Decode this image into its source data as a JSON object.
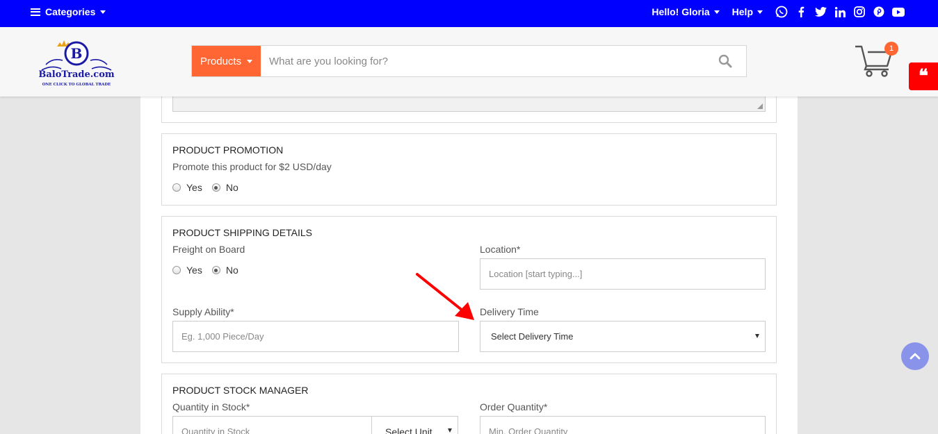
{
  "topbar": {
    "categories_label": "Categories",
    "greeting": "Hello! Gloria",
    "help_label": "Help",
    "social_icons": [
      "whatsapp-icon",
      "facebook-icon",
      "twitter-icon",
      "linkedin-icon",
      "instagram-icon",
      "pinterest-icon",
      "youtube-icon"
    ]
  },
  "header": {
    "logo_letter": "B",
    "logo_name": "BaloTrade.com",
    "logo_tagline": "ONE CLICK TO GLOBAL TRADE",
    "search_category": "Products",
    "search_placeholder": "What are you looking for?",
    "cart_count": "1"
  },
  "promotion": {
    "title": "PRODUCT PROMOTION",
    "description": "Promote this product for $2 USD/day",
    "options": [
      "Yes",
      "No"
    ],
    "selected": "No"
  },
  "shipping": {
    "title": "PRODUCT SHIPPING DETAILS",
    "fob_label": "Freight on Board",
    "fob_options": [
      "Yes",
      "No"
    ],
    "fob_selected": "No",
    "location_label": "Location*",
    "location_placeholder": "Location [start typing...]",
    "supply_label": "Supply Ability*",
    "supply_placeholder": "Eg. 1,000 Piece/Day",
    "delivery_label": "Delivery Time",
    "delivery_value": "Select Delivery Time"
  },
  "stock": {
    "title": "PRODUCT STOCK MANAGER",
    "quantity_label": "Quantity in Stock*",
    "quantity_placeholder": "Quantity in Stock",
    "unit_value": "Select Unit",
    "order_label": "Order Quantity*",
    "order_placeholder": "Min. Order Quantity"
  },
  "colors": {
    "topbar": "#0000ff",
    "accent": "#ff6633",
    "quote_tab": "#ff0000",
    "arrow": "#ff0000",
    "scroll_button": "#8a93ea"
  }
}
